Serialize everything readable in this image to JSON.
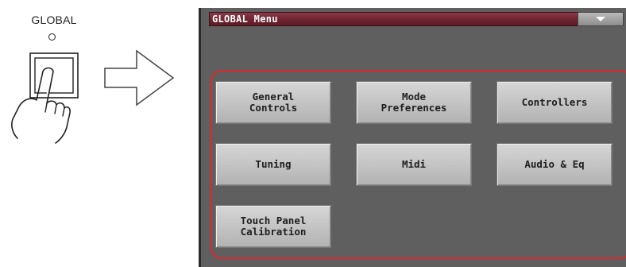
{
  "illustration": {
    "button_label": "GLOBAL"
  },
  "window": {
    "title": "GLOBAL Menu",
    "dropdown_icon": "triangle-down-icon"
  },
  "menu": {
    "buttons": [
      {
        "label": "General\nControls"
      },
      {
        "label": "Mode\nPreferences"
      },
      {
        "label": "Controllers"
      },
      {
        "label": "Tuning"
      },
      {
        "label": "Midi"
      },
      {
        "label": "Audio & Eq"
      },
      {
        "label": "Touch Panel\nCalibration"
      }
    ]
  },
  "colors": {
    "titlebar": "#6e2430",
    "screen_background": "#5f5f5f",
    "highlight": "#e0262d",
    "button": "#c4c4c4"
  }
}
